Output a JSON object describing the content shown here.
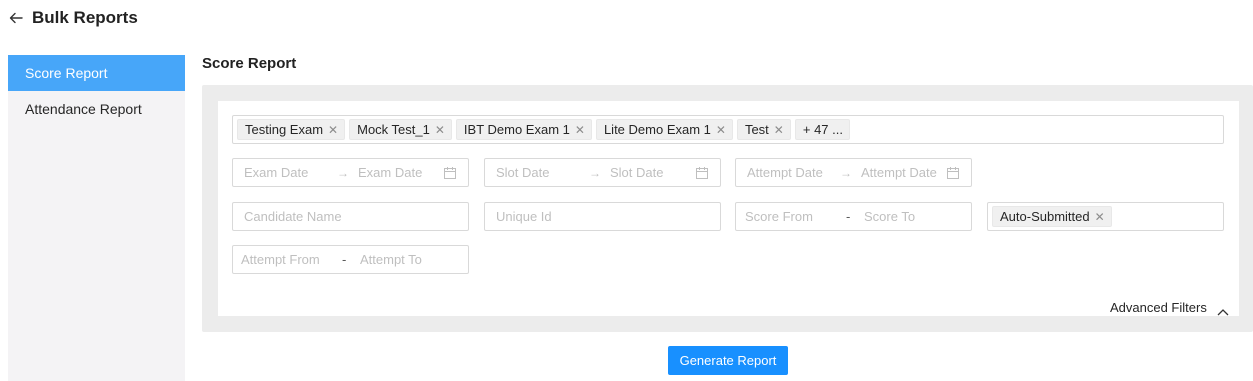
{
  "header": {
    "title": "Bulk Reports",
    "back_icon": "arrow-left-icon"
  },
  "sidebar": {
    "items": [
      {
        "label": "Score Report",
        "active": true
      },
      {
        "label": "Attendance Report",
        "active": false
      }
    ]
  },
  "main": {
    "section_title": "Score Report",
    "exam_tags": [
      {
        "label": "Testing Exam"
      },
      {
        "label": "Mock Test_1"
      },
      {
        "label": "IBT Demo Exam 1"
      },
      {
        "label": "Lite Demo Exam 1"
      },
      {
        "label": "Test"
      }
    ],
    "more_tags": "+ 47 ...",
    "exam_date": {
      "start_placeholder": "Exam Date",
      "end_placeholder": "Exam Date"
    },
    "slot_date": {
      "start_placeholder": "Slot Date",
      "end_placeholder": "Slot Date"
    },
    "attempt_date": {
      "start_placeholder": "Attempt Date",
      "end_placeholder": "Attempt Date"
    },
    "candidate_name": {
      "placeholder": "Candidate Name"
    },
    "unique_id": {
      "placeholder": "Unique Id"
    },
    "score": {
      "from_placeholder": "Score From",
      "separator": "-",
      "to_placeholder": "Score To"
    },
    "status_tag": "Auto-Submitted",
    "attempt": {
      "from_placeholder": "Attempt From",
      "separator": "-",
      "to_placeholder": "Attempt To"
    },
    "advanced_filters": "Advanced Filters",
    "generate_button": "Generate Report"
  },
  "colors": {
    "accent": "#1890ff",
    "sidebar_active": "#47a6f9",
    "panel_bg": "#ececec"
  }
}
